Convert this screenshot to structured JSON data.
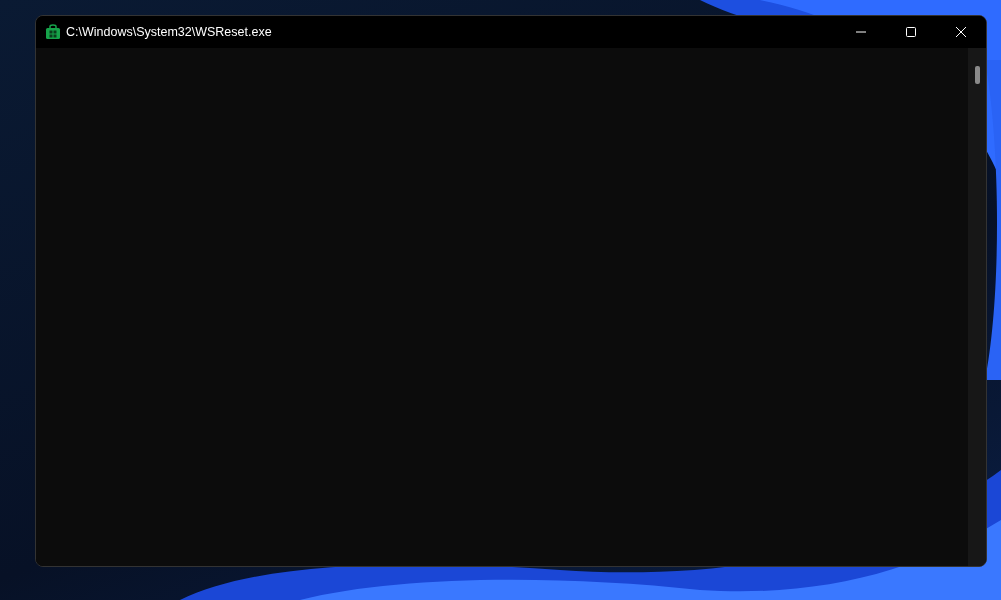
{
  "window": {
    "title": "C:\\Windows\\System32\\WSReset.exe"
  }
}
